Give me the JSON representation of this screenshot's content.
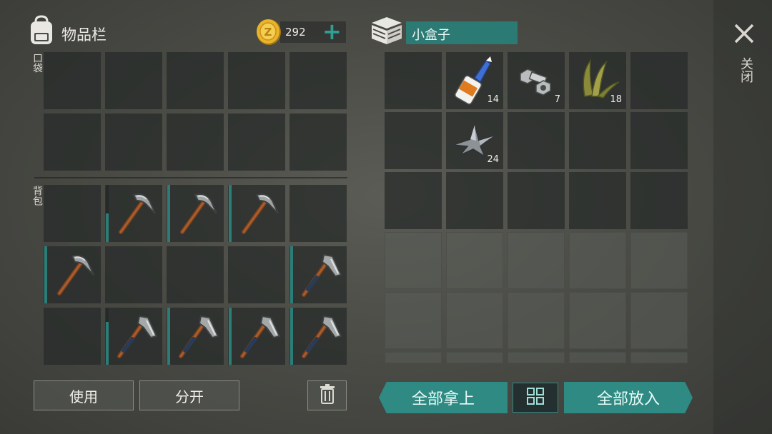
{
  "inventory": {
    "title": "物品栏",
    "pocket_label": "口袋",
    "backpack_label": "背包",
    "backpack_slots": [
      {
        "item": "",
        "durability": 0
      },
      {
        "item": "pickaxe-icon",
        "durability": 0.5
      },
      {
        "item": "pickaxe-icon",
        "durability": 1.0
      },
      {
        "item": "pickaxe-icon",
        "durability": 1.0
      },
      {
        "item": "",
        "durability": 0
      },
      {
        "item": "pickaxe-icon",
        "durability": 1.0
      },
      {
        "item": "",
        "durability": 0
      },
      {
        "item": "",
        "durability": 0
      },
      {
        "item": "",
        "durability": 0
      },
      {
        "item": "hatchet-icon",
        "durability": 1.0
      },
      {
        "item": "",
        "durability": 0
      },
      {
        "item": "hatchet-icon",
        "durability": 0.75
      },
      {
        "item": "hatchet-icon",
        "durability": 1.0
      },
      {
        "item": "hatchet-icon",
        "durability": 1.0
      },
      {
        "item": "hatchet-icon",
        "durability": 1.0
      }
    ]
  },
  "currency": {
    "coin_symbol": "Z",
    "amount": "292",
    "add_label": "+"
  },
  "container": {
    "name": "小盒子",
    "items": [
      {
        "slot": 1,
        "item": "glue-icon",
        "qty": "14"
      },
      {
        "slot": 2,
        "item": "bolt-nut-icon",
        "qty": "7"
      },
      {
        "slot": 3,
        "item": "plant-fiber-icon",
        "qty": "18"
      },
      {
        "slot": 6,
        "item": "scrap-metal-icon",
        "qty": "24"
      }
    ]
  },
  "buttons": {
    "use": "使用",
    "split": "分开",
    "take_all": "全部拿上",
    "put_all": "全部放入",
    "sort_icon": "grid-sort-icon",
    "trash_icon": "trash-icon"
  },
  "close": {
    "label": "关闭",
    "icon": "close-icon"
  },
  "colors": {
    "accent": "#2e8a83",
    "durability": "#2b7d78",
    "coin": "#e2b02a"
  }
}
